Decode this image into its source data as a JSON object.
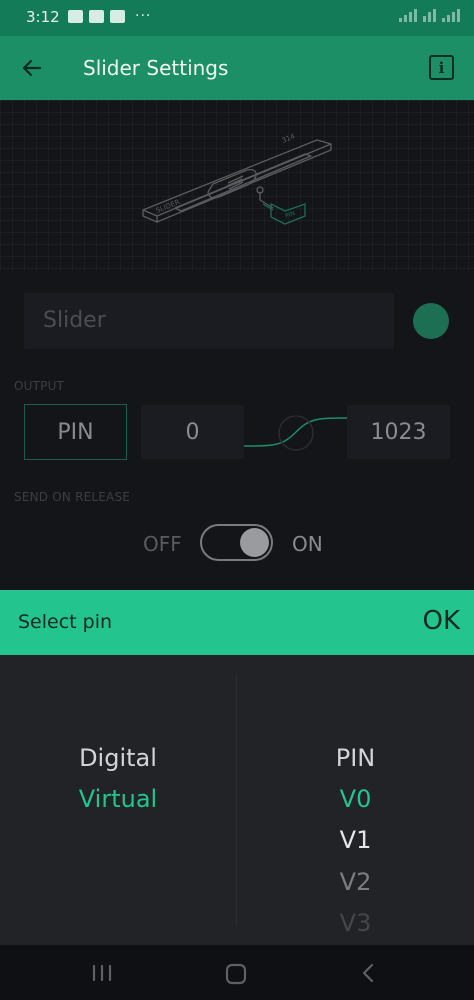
{
  "status_bar": {
    "time": "3:12",
    "notification_icons": [
      "image-icon",
      "mail-icon",
      "mail-icon"
    ],
    "more_indicator": "···",
    "signal_icons": [
      "signal-icon",
      "wifi-icon",
      "signal-icon"
    ]
  },
  "app_bar": {
    "title": "Slider Settings",
    "back_icon": "arrow-left-icon",
    "info_icon": "info-icon",
    "info_glyph": "i",
    "background": "#1c8f67"
  },
  "widget_preview": {
    "label": "SLIDER",
    "pin_tag": "PIN",
    "value_readout": "314"
  },
  "settings": {
    "name_value": "Slider",
    "color_swatch": "#1c6f52",
    "output_label": "OUTPUT",
    "pin_button_label": "PIN",
    "min_value": "0",
    "max_value": "1023",
    "send_on_release_label": "SEND ON RELEASE",
    "toggle_off_label": "OFF",
    "toggle_on_label": "ON",
    "send_on_release_on": true
  },
  "pin_picker": {
    "header_label": "Select pin",
    "ok_label": "OK",
    "accent_color": "#23c48e",
    "modes": [
      "Digital",
      "Virtual"
    ],
    "selected_mode": "Virtual",
    "pin_column_header": "PIN",
    "pins": [
      "V0",
      "V1",
      "V2",
      "V3"
    ],
    "selected_pin": "V0"
  },
  "nav_bar": {
    "recents_icon": "recents-icon",
    "home_icon": "home-icon",
    "back_icon": "chevron-left-icon"
  }
}
